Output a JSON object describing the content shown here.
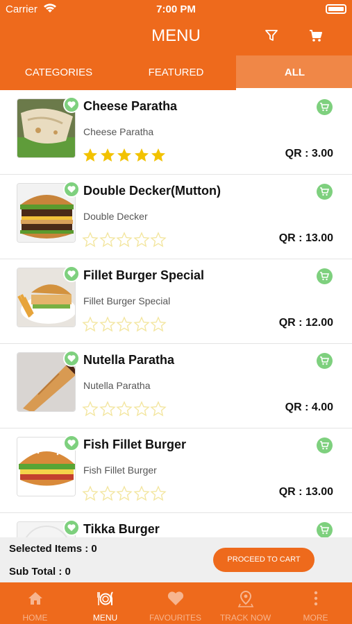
{
  "status_bar": {
    "carrier": "Carrier",
    "time": "7:00 PM"
  },
  "header": {
    "title": "MENU",
    "filter_icon": "filter-icon",
    "cart_icon": "cart-icon"
  },
  "tabs": [
    {
      "label": "CATEGORIES",
      "active": false
    },
    {
      "label": "FEATURED",
      "active": false
    },
    {
      "label": "ALL",
      "active": true
    }
  ],
  "items": [
    {
      "name": "Cheese Paratha",
      "description": "Cheese Paratha",
      "price": "QR : 3.00",
      "rating": 5
    },
    {
      "name": "Double Decker(Mutton)",
      "description": "Double Decker",
      "price": "QR : 13.00",
      "rating": 0
    },
    {
      "name": "Fillet Burger Special",
      "description": "Fillet Burger Special",
      "price": "QR : 12.00",
      "rating": 0
    },
    {
      "name": "Nutella Paratha",
      "description": "Nutella Paratha",
      "price": "QR : 4.00",
      "rating": 0
    },
    {
      "name": "Fish Fillet Burger",
      "description": "Fish Fillet Burger",
      "price": "QR : 13.00",
      "rating": 0
    },
    {
      "name": "Tikka Burger",
      "description": "",
      "price": "",
      "rating": 0
    }
  ],
  "summary": {
    "selected_items": "Selected Items : 0",
    "sub_total": "Sub Total : 0",
    "proceed_label": "PROCEED TO CART"
  },
  "bottom_nav": [
    {
      "label": "HOME",
      "icon": "home-icon",
      "active": false
    },
    {
      "label": "MENU",
      "icon": "menu-icon",
      "active": true
    },
    {
      "label": "FAVOURITES",
      "icon": "heart-icon",
      "active": false
    },
    {
      "label": "TRACK NOW",
      "icon": "location-icon",
      "active": false
    },
    {
      "label": "MORE",
      "icon": "more-icon",
      "active": false
    }
  ],
  "colors": {
    "accent": "#EE6A1C",
    "active_tab": "#F08747",
    "badge_green": "#7ED07E",
    "star_gold": "#F2C200"
  }
}
